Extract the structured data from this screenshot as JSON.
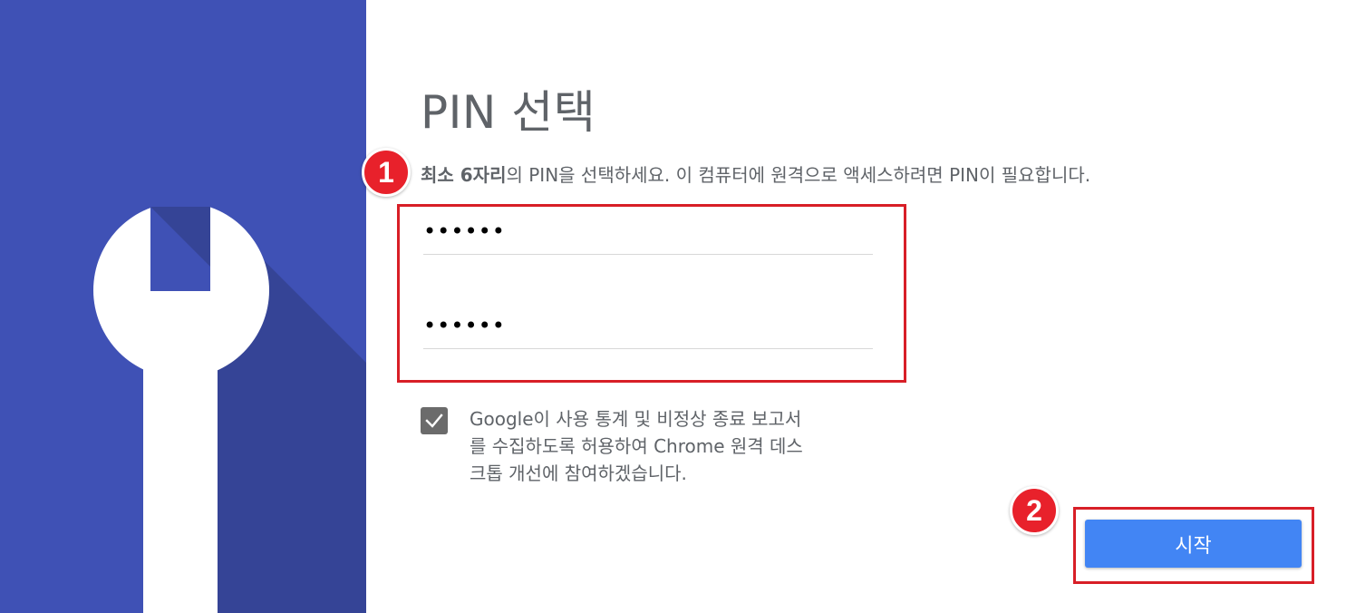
{
  "left_panel": {
    "background_color": "#3f51b5",
    "shadow_color": "#354496",
    "icon": "wrench-icon"
  },
  "title": "PIN 선택",
  "instruction": {
    "bold": "최소 6자리",
    "rest": "의 PIN을 선택하세요. 이 컴퓨터에 원격으로 액세스하려면 PIN이 필요합니다."
  },
  "pin_inputs": {
    "pin_value": "••••••",
    "confirm_value": "••••••"
  },
  "consent": {
    "checked": true,
    "line1": "Google이 사용 통계 및 비정상 종료 보고서",
    "line2": "를 수집하도록 허용하여 Chrome 원격 데스",
    "line3": "크톱 개선에 참여하겠습니다."
  },
  "start_button": {
    "label": "시작",
    "color": "#4285f4"
  },
  "annotations": {
    "badge1": "1",
    "badge2": "2",
    "color": "#e8212b"
  }
}
